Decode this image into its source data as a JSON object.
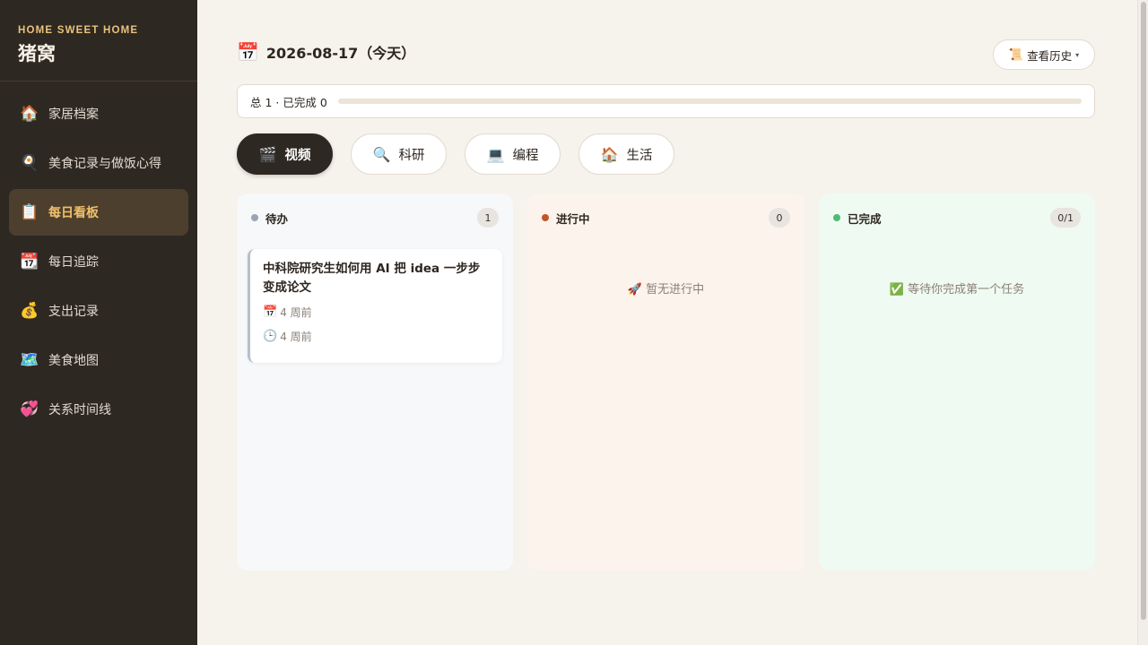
{
  "sidebar": {
    "eyebrow": "HOME SWEET HOME",
    "title": "猪窝",
    "items": [
      {
        "icon": "🏠",
        "icon_name": "house-icon",
        "label": "家居档案",
        "active": false
      },
      {
        "icon": "🍳",
        "icon_name": "frying-pan-icon",
        "label": "美食记录与做饭心得",
        "active": false
      },
      {
        "icon": "📋",
        "icon_name": "clipboard-icon",
        "label": "每日看板",
        "active": true
      },
      {
        "icon": "📆",
        "icon_name": "calendar-icon",
        "label": "每日追踪",
        "active": false
      },
      {
        "icon": "💰",
        "icon_name": "money-bag-icon",
        "label": "支出记录",
        "active": false
      },
      {
        "icon": "🗺️",
        "icon_name": "map-icon",
        "label": "美食地图",
        "active": false
      },
      {
        "icon": "💞",
        "icon_name": "hearts-icon",
        "label": "关系时间线",
        "active": false
      }
    ]
  },
  "header": {
    "date_icon": "📅",
    "date": "2026-08-17（今天）",
    "history_icon": "📜",
    "history_label": "查看历史",
    "history_caret": "▾"
  },
  "progress": {
    "text": "总 1 · 已完成 0",
    "completed_fraction": 0
  },
  "tabs": [
    {
      "icon": "🎬",
      "icon_name": "clapper-icon",
      "label": "视频",
      "active": true
    },
    {
      "icon": "🔍",
      "icon_name": "magnifier-icon",
      "label": "科研",
      "active": false
    },
    {
      "icon": "💻",
      "icon_name": "laptop-icon",
      "label": "编程",
      "active": false
    },
    {
      "icon": "🏠",
      "icon_name": "house-icon",
      "label": "生活",
      "active": false
    }
  ],
  "columns": {
    "todo": {
      "title": "待办",
      "count": "1",
      "dot_color": "#9aa5b4",
      "cards": [
        {
          "title": "中科院研究生如何用 AI 把 idea 一步步变成论文",
          "created_icon": "📅",
          "created": "4 周前",
          "updated_icon": "🕒",
          "updated": "4 周前"
        }
      ]
    },
    "doing": {
      "title": "进行中",
      "count": "0",
      "dot_color": "#c0562b",
      "empty_text": "🚀 暂无进行中"
    },
    "done": {
      "title": "已完成",
      "count": "0/1",
      "dot_color": "#4dbb77",
      "empty_text": "✅ 等待你完成第一个任务"
    }
  }
}
